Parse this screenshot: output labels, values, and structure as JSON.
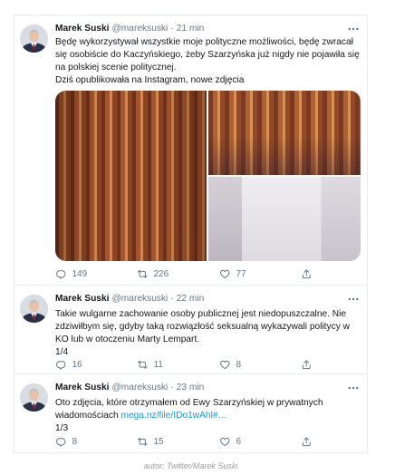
{
  "colors": {
    "text": "#14171a",
    "secondary": "#657786",
    "link": "#1b95e0",
    "border": "#e6ecf0",
    "caption": "#9b9b9b"
  },
  "icons": {
    "more": "more-icon",
    "reply": "reply-icon",
    "retweet": "retweet-icon",
    "like": "like-icon",
    "share": "share-icon"
  },
  "separator": "·",
  "tweets": [
    {
      "name": "Marek Suski",
      "handle": "@mareksuski",
      "time": "21 min",
      "lines": [
        "Będę wykorzystywał wszystkie moje polityczne możliwości, będę zwracał",
        "się osobiście do Kaczyńskiego, żeby Szarzyńska już nigdy nie pojawiła się",
        "na polskiej scenie politycznej.",
        "Dziś opublikowała na Instagram, nowe zdjęcia"
      ],
      "replies": "149",
      "retweets": "226",
      "likes": "77"
    },
    {
      "name": "Marek Suski",
      "handle": "@mareksuski",
      "time": "22 min",
      "lines": [
        "Takie wulgarne zachowanie osoby publicznej jest niedopuszczalne. Nie",
        "zdziwiłbym się, gdyby taką rozwiązłość seksualną wykazywali politycy w",
        "KO lub w otoczeniu Marty Lempart.",
        "1/4"
      ],
      "replies": "16",
      "retweets": "11",
      "likes": "8"
    },
    {
      "name": "Marek Suski",
      "handle": "@mareksuski",
      "time": "23 min",
      "lines": [
        "Oto zdjęcia, które otrzymałem od Ewy Szarzyńskiej w prywatnych",
        "wiadomościach",
        "1/3"
      ],
      "link": "mega.nz/file/IDo1wAhl#…",
      "replies": "8",
      "retweets": "15",
      "likes": "6"
    }
  ],
  "caption": "autor: Twitter/Marek Suski"
}
